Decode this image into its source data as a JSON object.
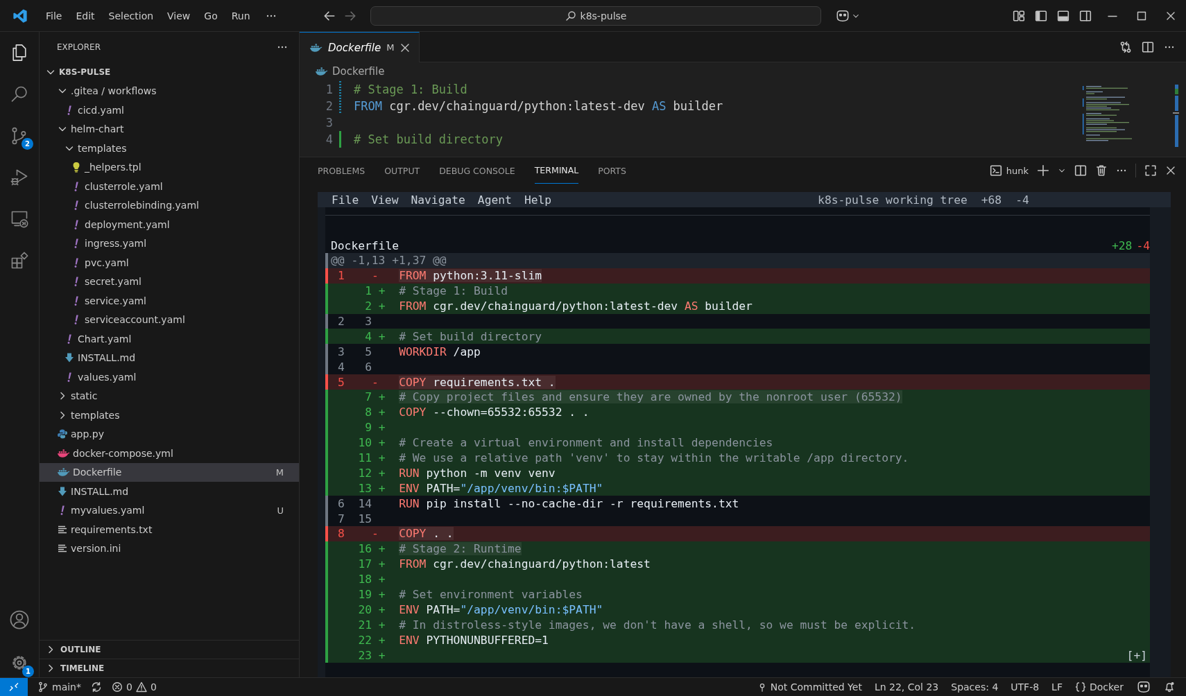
{
  "title_bar": {
    "menus": [
      "File",
      "Edit",
      "Selection",
      "View",
      "Go",
      "Run"
    ],
    "search": {
      "value": "k8s-pulse"
    }
  },
  "activity_bar": {
    "top": [
      {
        "kind": "files",
        "selected": true
      },
      {
        "kind": "search",
        "selected": false
      },
      {
        "kind": "source-control",
        "selected": false,
        "badge": "2"
      },
      {
        "kind": "run-debug",
        "selected": false
      },
      {
        "kind": "remote-explorer",
        "selected": false
      },
      {
        "kind": "extensions",
        "selected": false
      }
    ],
    "bottom": [
      {
        "kind": "account"
      },
      {
        "kind": "settings",
        "badge": "1"
      }
    ]
  },
  "sidebar": {
    "title": "EXPLORER",
    "root": {
      "label": "K8S-PULSE",
      "expanded": true
    },
    "items": [
      {
        "kind": "folder",
        "label": ".gitea / workflows",
        "expanded": true,
        "selected": false,
        "children": [
          {
            "kind": "yaml",
            "label": "cicd.yaml",
            "selected": false
          }
        ]
      },
      {
        "kind": "folder",
        "label": "helm-chart",
        "expanded": true,
        "selected": false,
        "children": [
          {
            "kind": "folder",
            "label": "templates",
            "expanded": true,
            "selected": false,
            "children": [
              {
                "kind": "tpl",
                "label": "_helpers.tpl",
                "selected": false
              },
              {
                "kind": "yaml",
                "label": "clusterrole.yaml",
                "selected": false
              },
              {
                "kind": "yaml",
                "label": "clusterrolebinding.yaml",
                "selected": false
              },
              {
                "kind": "yaml",
                "label": "deployment.yaml",
                "selected": false
              },
              {
                "kind": "yaml",
                "label": "ingress.yaml",
                "selected": false
              },
              {
                "kind": "yaml",
                "label": "pvc.yaml",
                "selected": false
              },
              {
                "kind": "yaml",
                "label": "secret.yaml",
                "selected": false
              },
              {
                "kind": "yaml",
                "label": "service.yaml",
                "selected": false
              },
              {
                "kind": "yaml",
                "label": "serviceaccount.yaml",
                "selected": false
              }
            ]
          },
          {
            "kind": "yaml",
            "label": "Chart.yaml",
            "selected": false
          },
          {
            "kind": "markdown",
            "label": "INSTALL.md",
            "selected": false
          },
          {
            "kind": "yaml",
            "label": "values.yaml",
            "selected": false
          }
        ]
      },
      {
        "kind": "folder",
        "label": "static",
        "expanded": false,
        "selected": false
      },
      {
        "kind": "folder",
        "label": "templates",
        "expanded": false,
        "selected": false
      },
      {
        "kind": "python",
        "label": "app.py",
        "selected": false
      },
      {
        "kind": "compose",
        "label": "docker-compose.yml",
        "selected": false
      },
      {
        "kind": "docker",
        "label": "Dockerfile",
        "selected": true,
        "badge": "M"
      },
      {
        "kind": "markdown",
        "label": "INSTALL.md",
        "selected": false
      },
      {
        "kind": "yaml",
        "label": "myvalues.yaml",
        "selected": false,
        "badge": "U"
      },
      {
        "kind": "text",
        "label": "requirements.txt",
        "selected": false
      },
      {
        "kind": "text",
        "label": "version.ini",
        "selected": false
      }
    ],
    "sections": [
      {
        "label": "OUTLINE",
        "expanded": false
      },
      {
        "label": "TIMELINE",
        "expanded": false
      }
    ]
  },
  "editor": {
    "tabs": [
      {
        "label": "Dockerfile",
        "badge": "M",
        "selected": true,
        "preview": true
      }
    ],
    "breadcrumb": "Dockerfile",
    "lines": [
      {
        "number": "1",
        "modified": true,
        "added": false,
        "code": [
          {
            "kind": "comment",
            "text": "# Stage 1: Build"
          }
        ]
      },
      {
        "number": "2",
        "modified": true,
        "added": false,
        "code": [
          {
            "kind": "keyword",
            "text": "FROM"
          },
          {
            "kind": "plain",
            "text": " cgr.dev/chainguard/python:latest-dev "
          },
          {
            "kind": "keyword",
            "text": "AS"
          },
          {
            "kind": "plain",
            "text": " builder"
          }
        ]
      },
      {
        "number": "3",
        "modified": false,
        "added": false
      },
      {
        "number": "4",
        "modified": false,
        "added": true,
        "code": [
          {
            "kind": "comment",
            "text": "# Set build directory"
          }
        ]
      }
    ]
  },
  "panel": {
    "tabs": [
      {
        "label": "PROBLEMS",
        "selected": false
      },
      {
        "label": "OUTPUT",
        "selected": false
      },
      {
        "label": "DEBUG CONSOLE",
        "selected": false
      },
      {
        "label": "TERMINAL",
        "selected": true
      },
      {
        "label": "PORTS",
        "selected": false
      }
    ],
    "terminal_name": "hunk"
  },
  "terminal": {
    "menus": [
      "File",
      "View",
      "Navigate",
      "Agent",
      "Help"
    ],
    "title": "k8s-pulse working tree",
    "added": "+68",
    "removed": "-4",
    "file": {
      "name": "Dockerfile",
      "added": "+28",
      "removed": "-4"
    },
    "hunk": "@@ -1,13 +1,37 @@",
    "expand": "[+]",
    "rows": [
      {
        "kind": "removed",
        "old": "1",
        "sign": "-",
        "highlight": true,
        "code": [
          {
            "kind": "keyword",
            "text": "FROM"
          },
          {
            "kind": "plain",
            "text": " python:3.11-slim"
          }
        ]
      },
      {
        "kind": "added",
        "new": "1",
        "sign": "+",
        "code": [
          {
            "kind": "comment",
            "text": "# Stage 1: Build"
          }
        ]
      },
      {
        "kind": "added",
        "new": "2",
        "sign": "+",
        "code": [
          {
            "kind": "keyword",
            "text": "FROM"
          },
          {
            "kind": "plain",
            "text": " cgr.dev/chainguard/python:latest-dev "
          },
          {
            "kind": "keyword",
            "text": "AS"
          },
          {
            "kind": "plain",
            "text": " builder"
          }
        ]
      },
      {
        "kind": "context",
        "old": "2",
        "new": "3"
      },
      {
        "kind": "added",
        "new": "4",
        "sign": "+",
        "code": [
          {
            "kind": "comment",
            "text": "# Set build directory"
          }
        ]
      },
      {
        "kind": "context",
        "old": "3",
        "new": "5",
        "code": [
          {
            "kind": "keyword",
            "text": "WORKDIR"
          },
          {
            "kind": "plain",
            "text": " /app"
          }
        ]
      },
      {
        "kind": "context",
        "old": "4",
        "new": "6"
      },
      {
        "kind": "removed",
        "old": "5",
        "sign": "-",
        "highlight": true,
        "code": [
          {
            "kind": "keyword",
            "text": "COPY"
          },
          {
            "kind": "plain",
            "text": " requirements.txt ."
          }
        ]
      },
      {
        "kind": "added",
        "new": "7",
        "sign": "+",
        "highlight": true,
        "code": [
          {
            "kind": "comment",
            "text": "# Copy project files and ensure they are owned by the nonroot user (65532)"
          }
        ]
      },
      {
        "kind": "added",
        "new": "8",
        "sign": "+",
        "code": [
          {
            "kind": "keyword",
            "text": "COPY"
          },
          {
            "kind": "plain",
            "text": " --chown=65532:65532 . ."
          }
        ]
      },
      {
        "kind": "added",
        "new": "9",
        "sign": "+"
      },
      {
        "kind": "added",
        "new": "10",
        "sign": "+",
        "code": [
          {
            "kind": "comment",
            "text": "# Create a virtual environment and install dependencies"
          }
        ]
      },
      {
        "kind": "added",
        "new": "11",
        "sign": "+",
        "code": [
          {
            "kind": "comment",
            "text": "# We use a relative path 'venv' to stay within the writable /app directory."
          }
        ]
      },
      {
        "kind": "added",
        "new": "12",
        "sign": "+",
        "code": [
          {
            "kind": "keyword",
            "text": "RUN"
          },
          {
            "kind": "plain",
            "text": " python -m venv venv"
          }
        ]
      },
      {
        "kind": "added",
        "new": "13",
        "sign": "+",
        "code": [
          {
            "kind": "keyword",
            "text": "ENV"
          },
          {
            "kind": "plain",
            "text": " PATH="
          },
          {
            "kind": "string",
            "text": "\"/app/venv/bin:$PATH\""
          }
        ]
      },
      {
        "kind": "context",
        "old": "6",
        "new": "14",
        "code": [
          {
            "kind": "keyword",
            "text": "RUN"
          },
          {
            "kind": "plain",
            "text": " pip install --no-cache-dir -r requirements.txt"
          }
        ]
      },
      {
        "kind": "context",
        "old": "7",
        "new": "15"
      },
      {
        "kind": "removed",
        "old": "8",
        "sign": "-",
        "highlight": true,
        "code": [
          {
            "kind": "keyword",
            "text": "COPY"
          },
          {
            "kind": "plain",
            "text": " . ."
          }
        ]
      },
      {
        "kind": "added",
        "new": "16",
        "sign": "+",
        "highlight": true,
        "code": [
          {
            "kind": "comment",
            "text": "# Stage 2: Runtime"
          }
        ]
      },
      {
        "kind": "added",
        "new": "17",
        "sign": "+",
        "code": [
          {
            "kind": "keyword",
            "text": "FROM"
          },
          {
            "kind": "plain",
            "text": " cgr.dev/chainguard/python:latest"
          }
        ]
      },
      {
        "kind": "added",
        "new": "18",
        "sign": "+"
      },
      {
        "kind": "added",
        "new": "19",
        "sign": "+",
        "code": [
          {
            "kind": "comment",
            "text": "# Set environment variables"
          }
        ]
      },
      {
        "kind": "added",
        "new": "20",
        "sign": "+",
        "code": [
          {
            "kind": "keyword",
            "text": "ENV"
          },
          {
            "kind": "plain",
            "text": " PATH="
          },
          {
            "kind": "string",
            "text": "\"/app/venv/bin:$PATH\""
          }
        ]
      },
      {
        "kind": "added",
        "new": "21",
        "sign": "+",
        "code": [
          {
            "kind": "comment",
            "text": "# In distroless-style images, we don't have a shell, so we must be explicit."
          }
        ]
      },
      {
        "kind": "added",
        "new": "22",
        "sign": "+",
        "code": [
          {
            "kind": "keyword",
            "text": "ENV"
          },
          {
            "kind": "plain",
            "text": " PYTHONUNBUFFERED=1"
          }
        ]
      },
      {
        "kind": "added",
        "new": "23",
        "sign": "+"
      }
    ]
  },
  "status_bar": {
    "branch": "main*",
    "errors": "0",
    "warnings": "0",
    "right": [
      {
        "kind": "blame",
        "text": "Not Committed Yet"
      },
      {
        "kind": "text",
        "text": "Ln 22, Col 23"
      },
      {
        "kind": "text",
        "text": "Spaces: 4"
      },
      {
        "kind": "text",
        "text": "UTF-8"
      },
      {
        "kind": "text",
        "text": "LF"
      },
      {
        "kind": "language",
        "text": "Docker"
      },
      {
        "kind": "copilot"
      },
      {
        "kind": "bell"
      }
    ]
  }
}
